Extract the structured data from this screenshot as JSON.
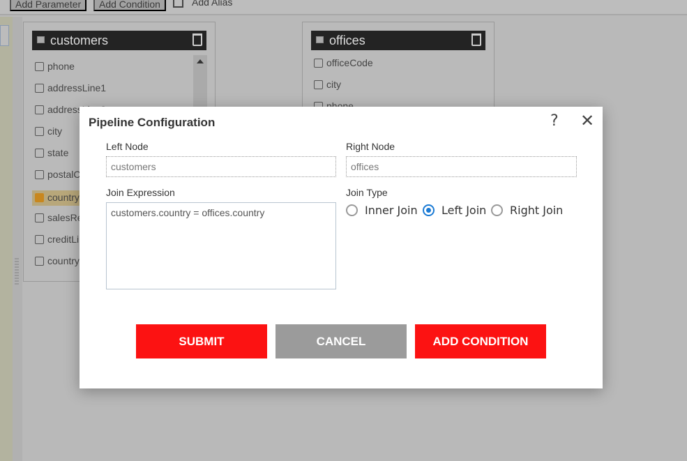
{
  "toolbar": {
    "add_parameter": "Add Parameter",
    "add_condition": "Add Condition",
    "add_alias": "Add Alias"
  },
  "nodes": [
    {
      "title": "customers",
      "fields": [
        {
          "name": "phone",
          "checked": false
        },
        {
          "name": "addressLine1",
          "checked": false
        },
        {
          "name": "addressLine2",
          "checked": false
        },
        {
          "name": "city",
          "checked": false
        },
        {
          "name": "state",
          "checked": false
        },
        {
          "name": "postalCode",
          "checked": false
        },
        {
          "name": "country",
          "checked": true
        },
        {
          "name": "salesRep",
          "checked": false
        },
        {
          "name": "creditLimit",
          "checked": false
        },
        {
          "name": "country",
          "checked": false
        }
      ]
    },
    {
      "title": "offices",
      "fields": [
        {
          "name": "officeCode",
          "checked": false
        },
        {
          "name": "city",
          "checked": false
        },
        {
          "name": "phone",
          "checked": false
        }
      ]
    }
  ],
  "modal": {
    "title": "Pipeline Configuration",
    "left_node_label": "Left Node",
    "left_node_value": "customers",
    "right_node_label": "Right Node",
    "right_node_value": "offices",
    "join_expression_label": "Join Expression",
    "join_expression_value": "customers.country = offices.country",
    "join_type_label": "Join Type",
    "join_types": [
      {
        "label": "Inner Join",
        "selected": false
      },
      {
        "label": "Left Join",
        "selected": true
      },
      {
        "label": "Right Join",
        "selected": false
      }
    ],
    "submit": "SUBMIT",
    "cancel": "CANCEL",
    "add_condition": "ADD CONDITION"
  },
  "colors": {
    "accent_red": "#fc1212",
    "cancel_gray": "#9b9b9b",
    "radio_blue": "#1a7ad4",
    "checked_orange": "#c8871e"
  }
}
